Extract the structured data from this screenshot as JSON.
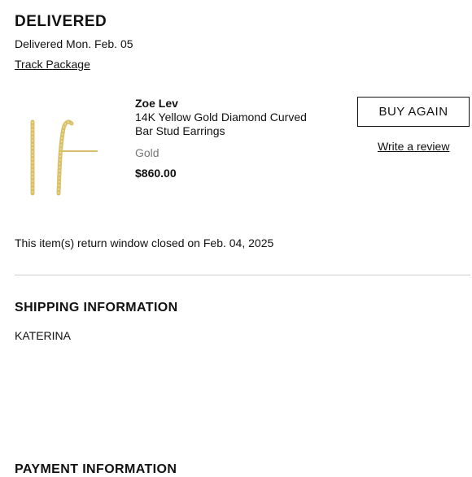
{
  "status": {
    "heading": "DELIVERED",
    "date": "Delivered Mon. Feb. 05",
    "track_label": "Track Package"
  },
  "item": {
    "image_icon": "gold-curved-bar-earrings",
    "brand": "Zoe Lev",
    "name": "14K Yellow Gold Diamond Curved Bar Stud Earrings",
    "color": "Gold",
    "price": "$860.00",
    "buy_again_label": "BUY AGAIN",
    "review_label": "Write a review"
  },
  "return_window": "This item(s) return window closed on Feb. 04, 2025",
  "shipping": {
    "heading": "SHIPPING INFORMATION",
    "name": "KATERINA"
  },
  "payment": {
    "heading": "PAYMENT INFORMATION"
  },
  "colors": {
    "text": "#111111",
    "muted": "#777777",
    "divider": "#cfcfcf",
    "gold": "#d9c16a"
  }
}
